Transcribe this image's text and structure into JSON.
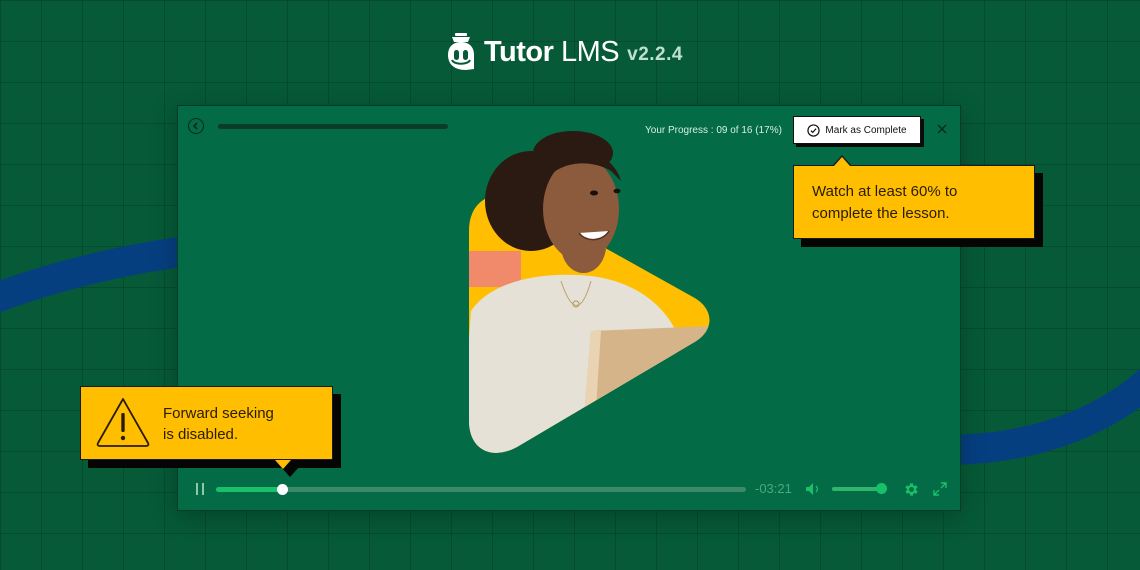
{
  "brand": {
    "name_bold": "Tutor",
    "name_regular": " LMS",
    "version": "v2.2.4",
    "icon": "tutor-owl-logo-icon"
  },
  "player": {
    "back_icon": "chevron-left-circle-icon",
    "progress_label": "Your Progress : 09 of 16 (17%)",
    "progress": {
      "completed": 9,
      "total": 16,
      "percent": 17
    },
    "mark_complete_label": "Mark as Complete",
    "mark_complete_icon": "check-circle-icon",
    "close_icon": "close-icon",
    "video": {
      "state": "playing",
      "played_fraction": 0.125,
      "time_remaining": "-03:21",
      "volume_fraction": 0.9
    },
    "controls": {
      "pause_icon": "pause-icon",
      "volume_icon": "volume-icon",
      "settings_icon": "gear-icon",
      "fullscreen_icon": "fullscreen-icon"
    }
  },
  "tooltips": {
    "completion": "Watch at least 60% to complete the lesson.",
    "completion_lines": [
      "Watch at least 60% to",
      "complete the lesson."
    ],
    "seeking_lines": [
      "Forward seeking",
      "is disabled."
    ],
    "seeking_icon": "warning-icon"
  },
  "colors": {
    "background": "#065a38",
    "player": "#036b45",
    "accent_green": "#19c06a",
    "tooltip_yellow": "#ffbf00",
    "wave_blue": "#063f80"
  }
}
